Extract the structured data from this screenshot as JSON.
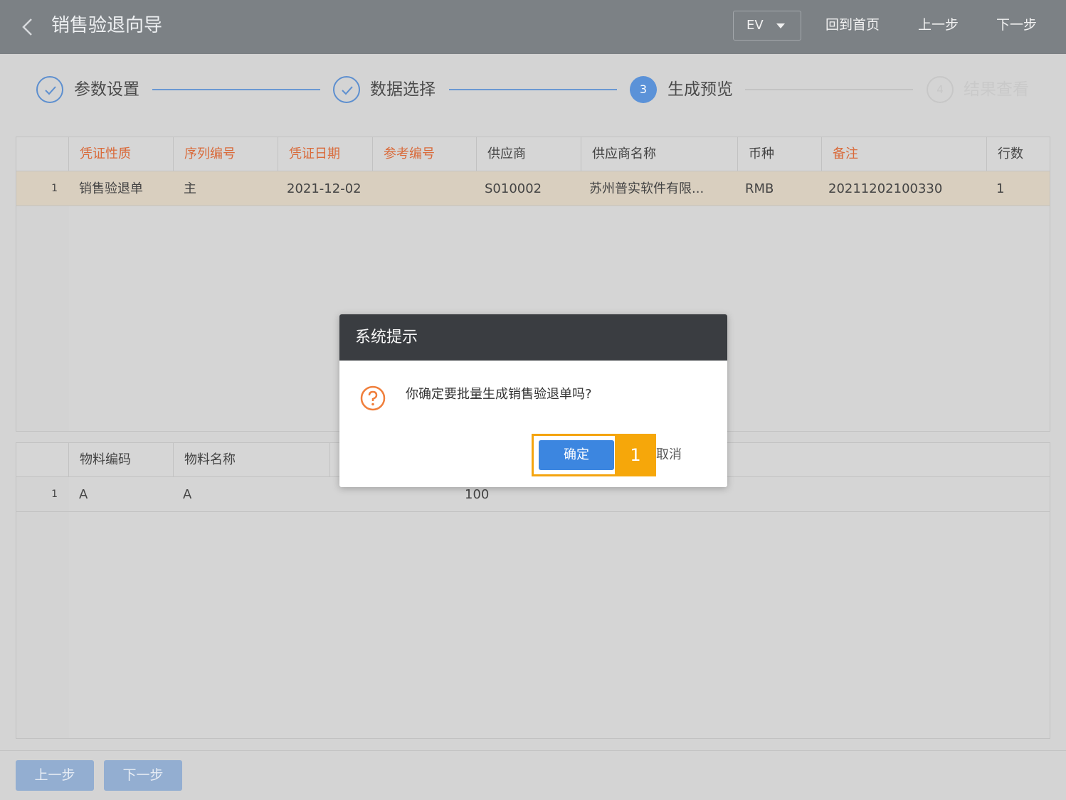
{
  "header": {
    "title": "销售验退向导",
    "lang_select": "EV",
    "home_label": "回到首页",
    "prev_label": "上一步",
    "next_label": "下一步"
  },
  "steps": [
    {
      "label": "参数设置",
      "status": "done"
    },
    {
      "label": "数据选择",
      "status": "done"
    },
    {
      "num": "3",
      "label": "生成预览",
      "status": "active"
    },
    {
      "num": "4",
      "label": "结果查看",
      "status": "pending"
    }
  ],
  "top_table": {
    "columns": [
      "凭证性质",
      "序列编号",
      "凭证日期",
      "参考编号",
      "供应商",
      "供应商名称",
      "币种",
      "备注",
      "行数"
    ],
    "rows": [
      {
        "num": "1",
        "cells": [
          "销售验退单",
          "主",
          "2021-12-02",
          "",
          "S010002",
          "苏州普实软件有限...",
          "RMB",
          "20211202100330",
          "1"
        ]
      }
    ]
  },
  "bottom_table": {
    "columns": [
      "物料编码",
      "物料名称"
    ],
    "rows": [
      {
        "num": "1",
        "code": "A",
        "name": "A",
        "qty": "100"
      }
    ]
  },
  "footer": {
    "prev_label": "上一步",
    "next_label": "下一步"
  },
  "dialog": {
    "title": "系统提示",
    "message": "你确定要批量生成销售验退单吗?",
    "ok_label": "确定",
    "cancel_label": "取消",
    "step_badge": "1"
  },
  "colors": {
    "header_bg": "#7c8185",
    "required_header": "#d96a3a",
    "accent_blue": "#3c86e0",
    "highlight_orange": "#f4a40f"
  }
}
